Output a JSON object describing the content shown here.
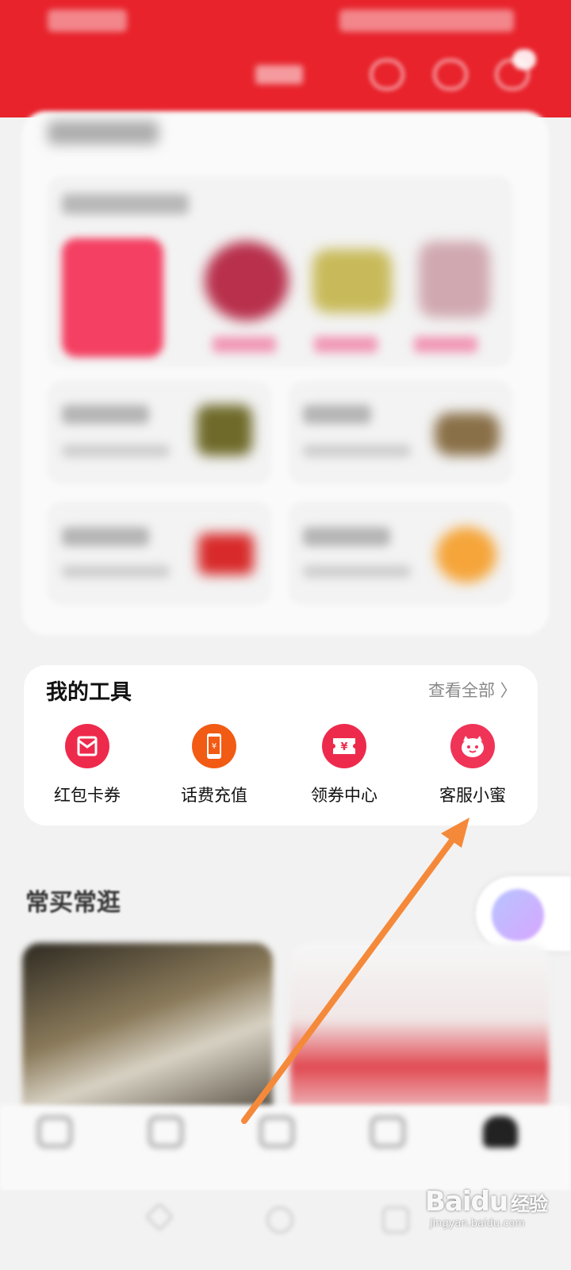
{
  "tools": {
    "title": "我的工具",
    "view_all": "查看全部 〉",
    "items": [
      {
        "label": "红包卡券",
        "icon": "red-envelope-icon",
        "color": "#ee2a4c"
      },
      {
        "label": "话费充值",
        "icon": "phone-recharge-icon",
        "color": "#f25b14"
      },
      {
        "label": "领券中心",
        "icon": "coupon-ticket-icon",
        "color": "#ee2a4c"
      },
      {
        "label": "客服小蜜",
        "icon": "customer-service-bot-icon",
        "color": "#ef3457"
      }
    ]
  },
  "section": {
    "title": "常买常逛"
  },
  "coupon_symbol": "¥",
  "watermark": {
    "logo": "Baidu",
    "logo_cn": "经验",
    "url": "jingyan.baidu.com"
  },
  "colors": {
    "header": "#e8232c",
    "arrow": "#f5893a",
    "card": "#ffffff",
    "background": "#f2f2f2"
  }
}
